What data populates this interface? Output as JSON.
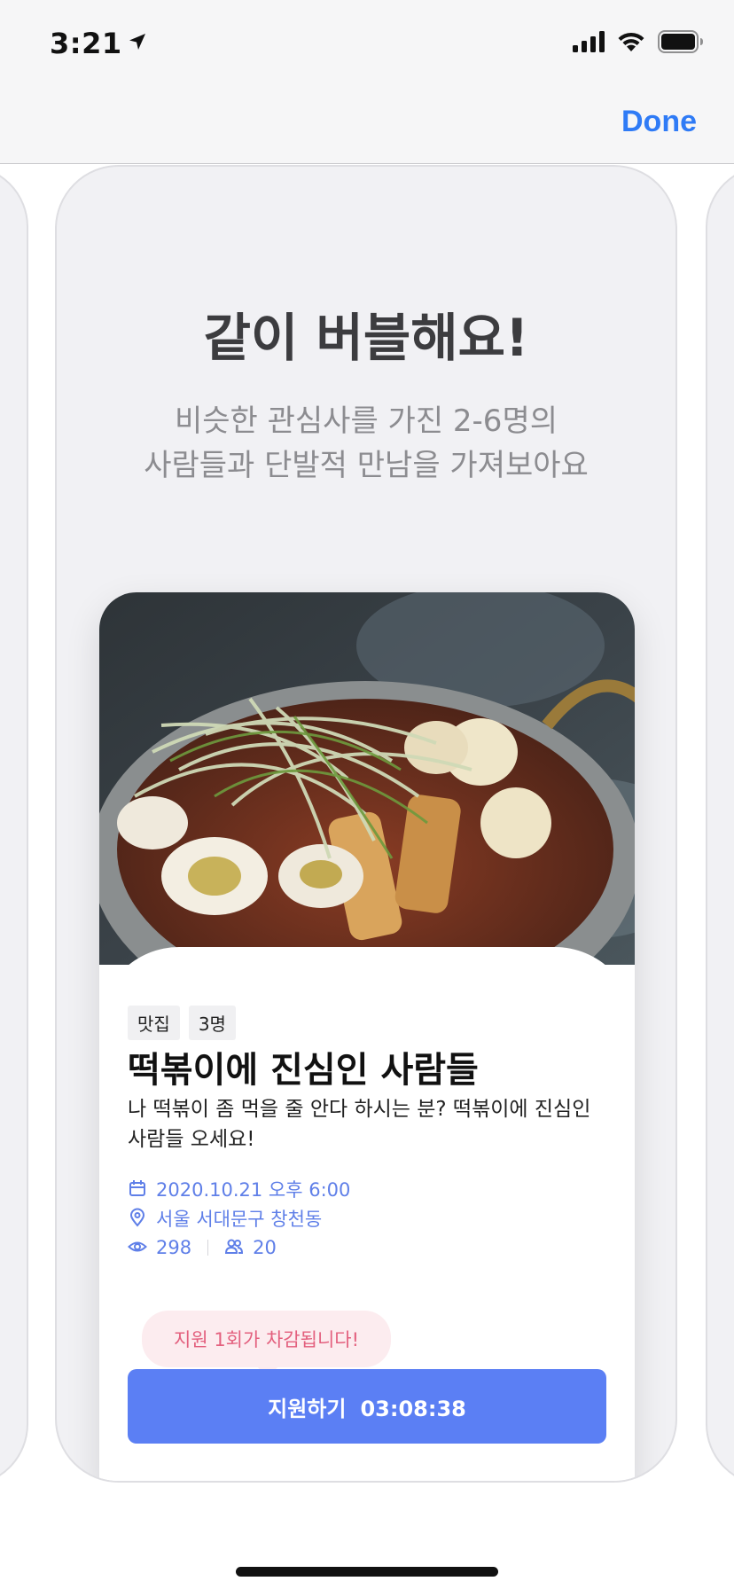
{
  "status_bar": {
    "time": "3:21",
    "icons": [
      "location-arrow-icon",
      "cellular-signal-icon",
      "wifi-icon",
      "battery-icon"
    ]
  },
  "nav": {
    "done_label": "Done",
    "accent": "#2f7bf6"
  },
  "slide": {
    "title": "같이 버블해요!",
    "subtitle_line1": "비슷한 관심사를 가진 2-6명의",
    "subtitle_line2": "사람들과 단발적 만남을 가져보아요"
  },
  "card": {
    "image": "tteokbokki-photo",
    "tags": [
      "맛집",
      "3명"
    ],
    "title": "떡볶이에 진심인 사람들",
    "description": "나 떡볶이 좀 먹을 줄 안다 하시는 분? 떡볶이에 진심인 사람들 오세요!",
    "datetime": "2020.10.21 오후 6:00",
    "location": "서울 서대문구 창천동",
    "views": "298",
    "members": "20",
    "meta_color": "#5f7fe8"
  },
  "apply": {
    "tooltip": "지원 1회가 차감됩니다!",
    "button_label": "지원하기",
    "countdown": "03:08:38",
    "button_color": "#5b7ff4"
  }
}
